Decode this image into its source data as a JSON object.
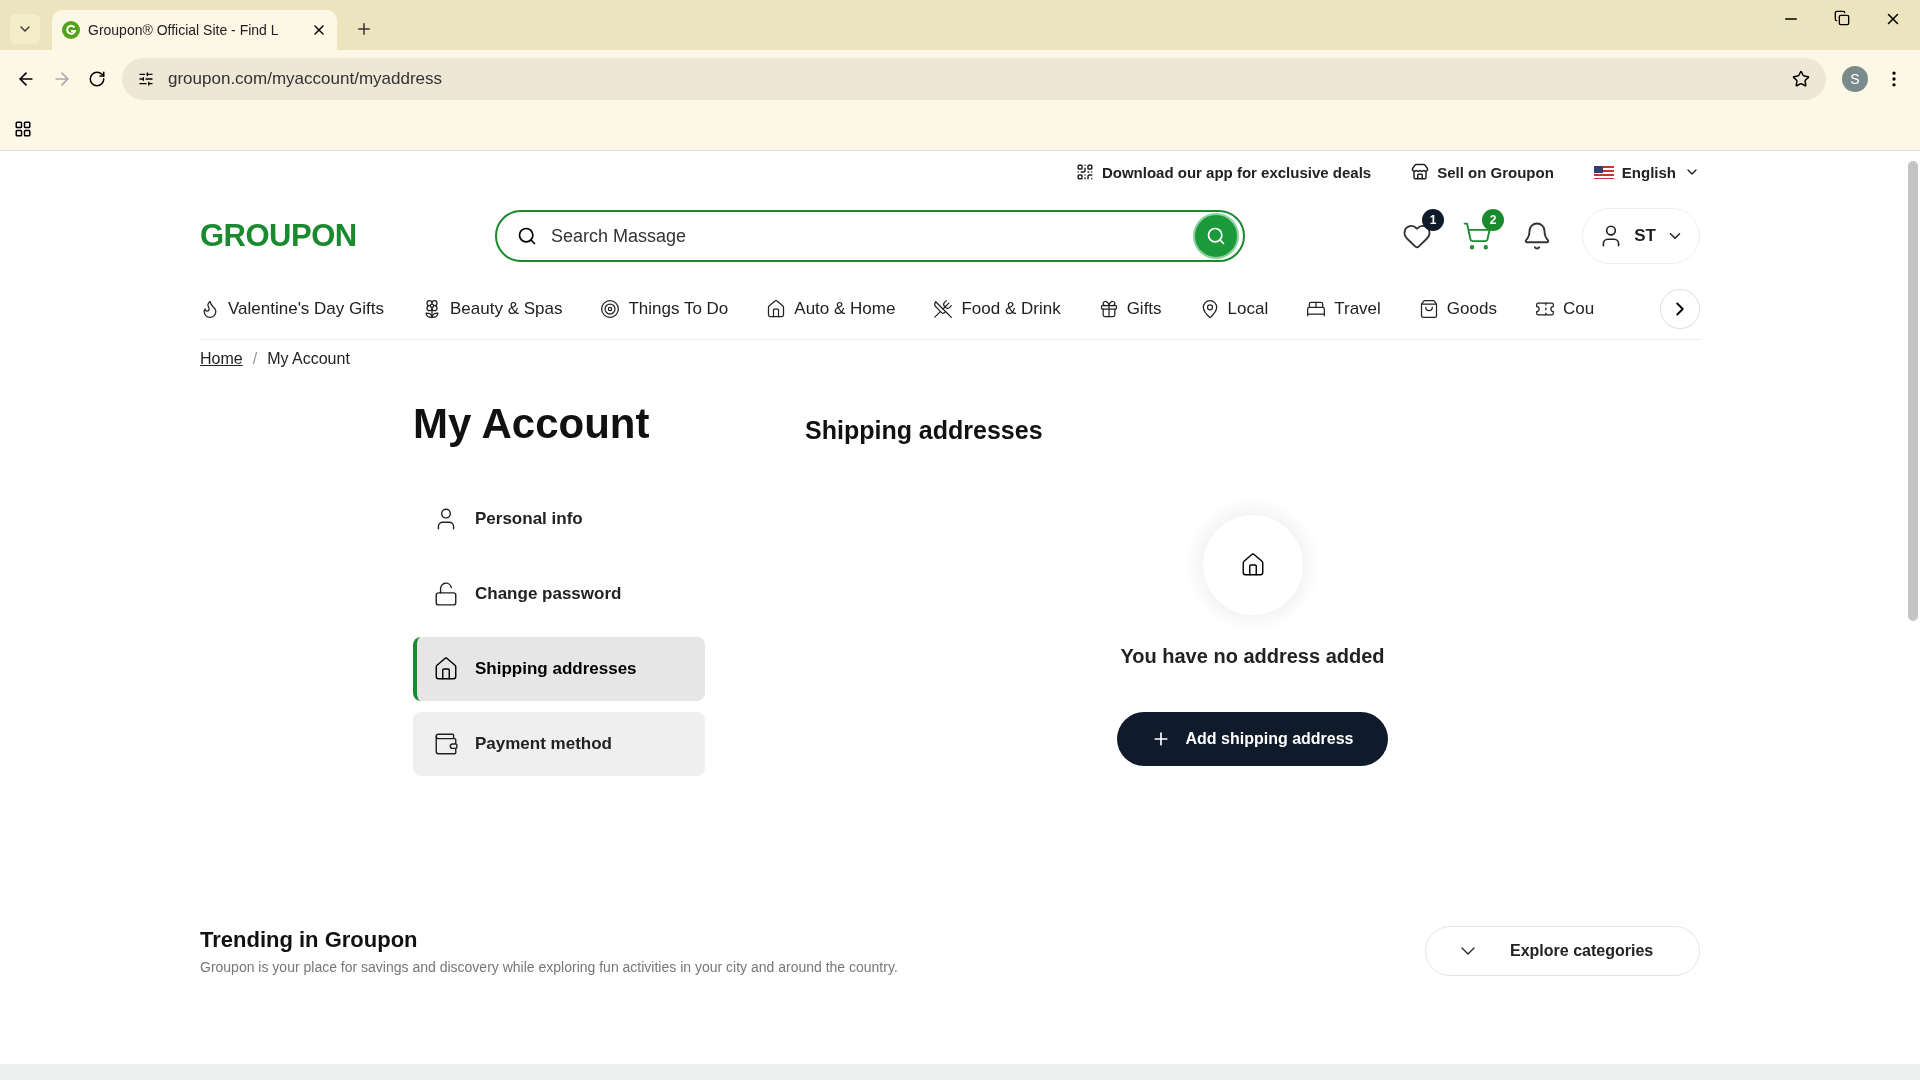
{
  "browser": {
    "tab_title": "Groupon® Official Site - Find L",
    "url": "groupon.com/myaccount/myaddress",
    "profile": "S"
  },
  "top_bar": {
    "links": [
      "Download our app for exclusive deals",
      "Sell on Groupon"
    ],
    "language": "English"
  },
  "header": {
    "logo": "GROUPON",
    "search": {
      "placeholder": "Search Massage"
    },
    "wishlist_count": "1",
    "cart_count": "2",
    "user_initials": "ST"
  },
  "categories": [
    "Valentine's Day Gifts",
    "Beauty & Spas",
    "Things To Do",
    "Auto & Home",
    "Food & Drink",
    "Gifts",
    "Local",
    "Travel",
    "Goods",
    "Cou"
  ],
  "breadcrumb": {
    "items": [
      "Home",
      "My Account"
    ],
    "separator": "/"
  },
  "account": {
    "title": "My Account",
    "menu": [
      {
        "label": "Personal info",
        "selected": false,
        "hovered": false
      },
      {
        "label": "Change password",
        "selected": false,
        "hovered": false
      },
      {
        "label": "Shipping addresses",
        "selected": true,
        "hovered": false
      },
      {
        "label": "Payment method",
        "selected": false,
        "hovered": true
      }
    ]
  },
  "shipping": {
    "title": "Shipping addresses",
    "empty_message": "You have no address added",
    "button": "Add shipping address"
  },
  "trending": {
    "title": "Trending in Groupon",
    "description": "Groupon is your place for savings and discovery while exploring fun activities in your city and around the country.",
    "explore": "Explore categories"
  }
}
